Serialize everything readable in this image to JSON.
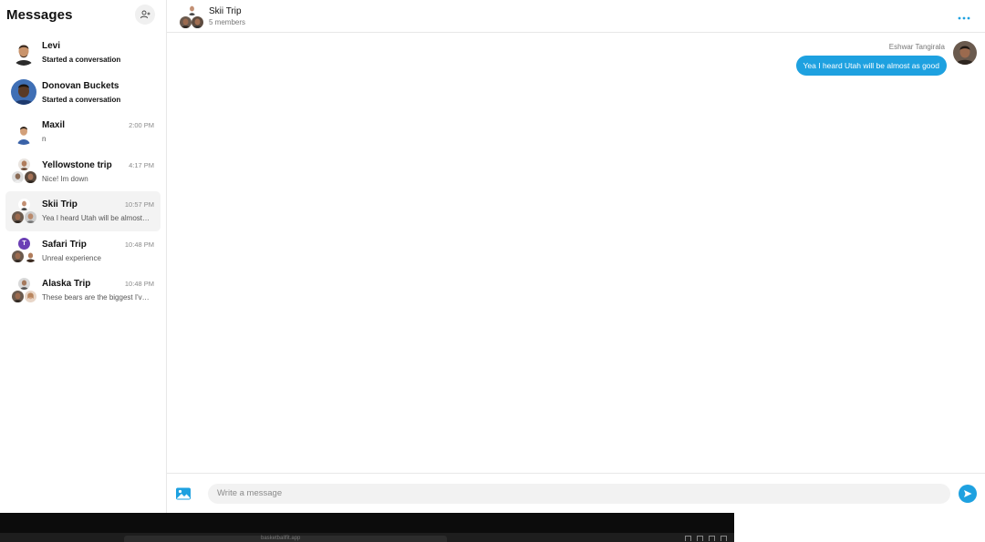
{
  "sidebar": {
    "title": "Messages",
    "conversations": [
      {
        "name": "Levi",
        "time": "",
        "preview": "Started a conversation",
        "preview_bold": true,
        "type": "single",
        "active": false
      },
      {
        "name": "Donovan Buckets",
        "time": "",
        "preview": "Started a conversation",
        "preview_bold": true,
        "type": "single",
        "active": false
      },
      {
        "name": "Maxil",
        "time": "2:00 PM",
        "preview": "n",
        "preview_bold": false,
        "type": "single",
        "active": false
      },
      {
        "name": "Yellowstone trip",
        "time": "4:17 PM",
        "preview": "Nice! Im down",
        "preview_bold": false,
        "type": "group",
        "active": false
      },
      {
        "name": "Skii Trip",
        "time": "10:57 PM",
        "preview": "Yea I heard Utah will be almost as good",
        "preview_bold": false,
        "type": "group",
        "active": true
      },
      {
        "name": "Safari Trip",
        "time": "10:48 PM",
        "preview": "Unreal experience",
        "preview_bold": false,
        "type": "group",
        "active": false,
        "group_initial": "T"
      },
      {
        "name": "Alaska Trip",
        "time": "10:48 PM",
        "preview": "These bears are the biggest I've ever seen",
        "preview_bold": false,
        "type": "group",
        "active": false
      }
    ]
  },
  "chat": {
    "title": "Skii Trip",
    "subtitle": "5 members",
    "messages": [
      {
        "sender": "Eshwar Tangirala",
        "text": "Yea I heard Utah will be almost as good"
      }
    ]
  },
  "composer": {
    "placeholder": "Write a message"
  },
  "browser": {
    "url": "basketballfit.app"
  },
  "colors": {
    "accent": "#1ea1e0",
    "active_row": "#f3f3f3",
    "border": "#e8e8e8"
  },
  "icons": {
    "add_user": "add-user-icon",
    "more": "more-horizontal-icon",
    "image": "image-icon",
    "send": "send-icon"
  }
}
